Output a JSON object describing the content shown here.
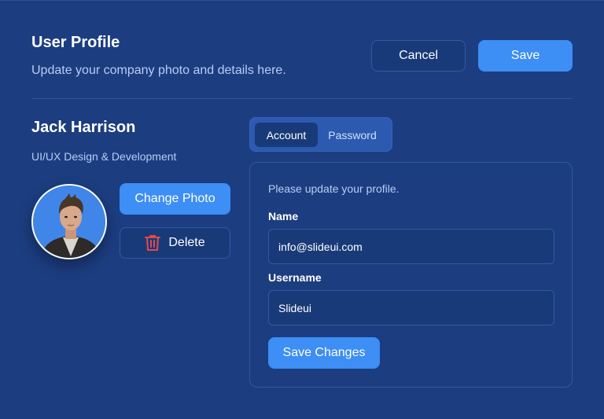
{
  "header": {
    "title": "User Profile",
    "subtitle": "Update your company photo and details here.",
    "cancel_label": "Cancel",
    "save_label": "Save"
  },
  "profile": {
    "name": "Jack Harrison",
    "role": "UI/UX Design & Development",
    "change_photo_label": "Change Photo",
    "delete_label": "Delete",
    "delete_icon": "trash-icon"
  },
  "tabs": [
    {
      "label": "Account",
      "active": true
    },
    {
      "label": "Password",
      "active": false
    }
  ],
  "form": {
    "hint": "Please update your profile.",
    "name_label": "Name",
    "name_value": "info@slideui.com",
    "username_label": "Username",
    "username_value": "Slideui",
    "submit_label": "Save Changes"
  },
  "colors": {
    "background": "#1c3d80",
    "accent": "#3d8ef5",
    "danger": "#e5484d",
    "muted_text": "#b7cdf3"
  }
}
